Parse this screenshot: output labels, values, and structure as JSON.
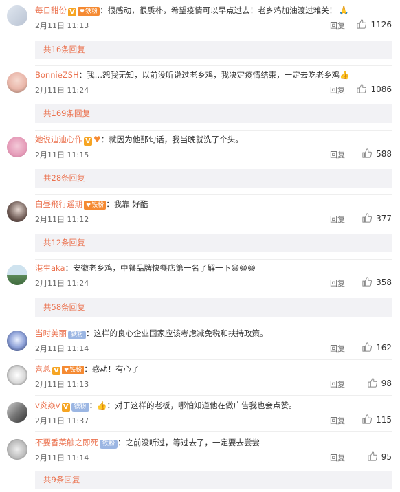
{
  "badges": {
    "iron_fan": "铁粉"
  },
  "actions": {
    "reply_label": "回复"
  },
  "comments": [
    {
      "user": "每日甜份",
      "verified": true,
      "fan_style": "orange",
      "text": "：很感动，很质朴，希望疫情可以早点过去！老乡鸡加油渡过难关！",
      "emoji": "pray",
      "time": "2月11日 11:13",
      "likes": "1126",
      "thread": "共16条回复"
    },
    {
      "user": "BonnieZSH",
      "verified": false,
      "fan_style": "",
      "text": "：我…恕我无知，以前没听说过老乡鸡，我决定疫情结束，一定去吃老乡鸡",
      "emoji": "thumb",
      "time": "2月11日 11:24",
      "likes": "1086",
      "thread": "共169条回复"
    },
    {
      "user": "她说迪迪心作",
      "verified": true,
      "fan_style": "heart",
      "text": "：就因为他那句话，我当晚就洗了个头。",
      "emoji": "",
      "time": "2月11日 11:15",
      "likes": "588",
      "thread": "共28条回复"
    },
    {
      "user": "白昼飛行遥期",
      "verified": false,
      "fan_style": "orange",
      "text": "：我靠 好酷",
      "emoji": "",
      "time": "2月11日 11:12",
      "likes": "377",
      "thread": "共12条回复"
    },
    {
      "user": "港生aka",
      "verified": false,
      "fan_style": "",
      "text": "：安徽老乡鸡，中餐品牌快餐店第一名了解一下",
      "emoji": "smile3",
      "time": "2月11日 11:24",
      "likes": "358",
      "thread": "共58条回复"
    },
    {
      "user": "当时美丽",
      "verified": false,
      "fan_style": "blue",
      "text": "：这样的良心企业国家应该考虑减免税和扶持政策。",
      "emoji": "",
      "time": "2月11日 11:14",
      "likes": "162",
      "thread": ""
    },
    {
      "user": "喜总",
      "verified": true,
      "fan_style": "orange",
      "text": "：感动！有心了",
      "emoji": "",
      "time": "2月11日 11:13",
      "likes": "98",
      "thread": ""
    },
    {
      "user": "v炎焱v",
      "verified": true,
      "fan_style": "blue",
      "text": "：对于这样的老板，哪怕知道他在做广告我也会点赞。",
      "emoji": "thumb-lead",
      "time": "2月11日 11:37",
      "likes": "115",
      "thread": ""
    },
    {
      "user": "不要香菜触之即死",
      "verified": false,
      "fan_style": "blue",
      "text": "：之前没听过，等过去了，一定要去尝尝",
      "emoji": "",
      "time": "2月11日 11:14",
      "likes": "95",
      "thread": "共9条回复"
    }
  ]
}
